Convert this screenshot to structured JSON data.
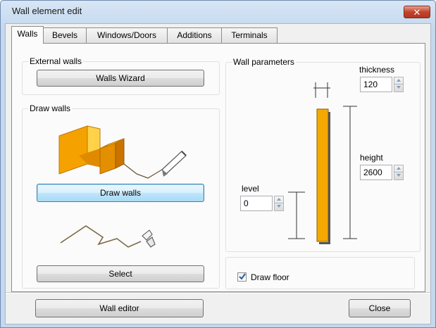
{
  "window": {
    "title": "Wall element edit",
    "close_glyph": "✕"
  },
  "tabs": [
    {
      "label": "Walls",
      "active": true
    },
    {
      "label": "Bevels",
      "active": false
    },
    {
      "label": "Windows/Doors",
      "active": false
    },
    {
      "label": "Additions",
      "active": false
    },
    {
      "label": "Terminals",
      "active": false
    }
  ],
  "external_walls": {
    "group_label": "External walls",
    "wizard_button": "Walls Wizard"
  },
  "draw_walls": {
    "group_label": "Draw walls",
    "draw_button": "Draw walls",
    "select_button": "Select"
  },
  "wall_parameters": {
    "group_label": "Wall parameters",
    "thickness_label": "thickness",
    "thickness_value": "120",
    "height_label": "height",
    "height_value": "2600",
    "level_label": "level",
    "level_value": "0"
  },
  "draw_floor": {
    "label": "Draw floor",
    "checked": true
  },
  "footer": {
    "wall_editor_button": "Wall editor",
    "close_button": "Close"
  },
  "colors": {
    "wall_orange": "#f5a800",
    "title_bar": "#c4d8ee",
    "close_red": "#c4432c"
  }
}
